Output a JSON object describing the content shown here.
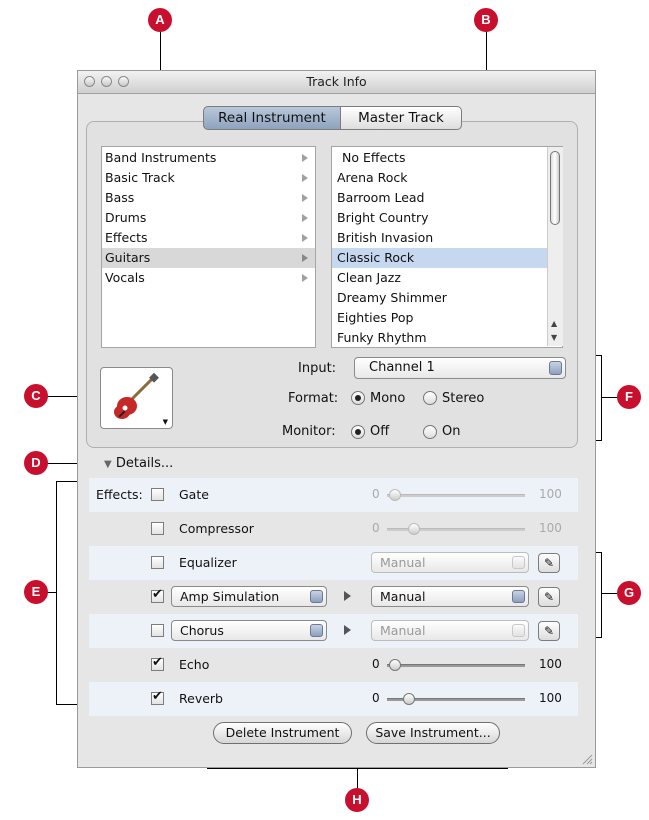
{
  "window": {
    "title": "Track Info"
  },
  "tabs": [
    {
      "label": "Real Instrument",
      "selected": true
    },
    {
      "label": "Master Track",
      "selected": false
    }
  ],
  "categories": [
    "Band Instruments",
    "Basic Track",
    "Bass",
    "Drums",
    "Effects",
    "Guitars",
    "Vocals"
  ],
  "selected_category": "Guitars",
  "presets": [
    "No Effects",
    "Arena Rock",
    "Barroom Lead",
    "Bright Country",
    "British Invasion",
    "Classic Rock",
    "Clean Jazz",
    "Dreamy Shimmer",
    "Eighties Pop",
    "Funky Rhythm"
  ],
  "selected_preset": "Classic Rock",
  "input": {
    "label": "Input:",
    "value": "Channel 1"
  },
  "format": {
    "label": "Format:",
    "options": [
      "Mono",
      "Stereo"
    ],
    "selected": "Mono"
  },
  "monitor": {
    "label": "Monitor:",
    "options": [
      "Off",
      "On"
    ],
    "selected": "Off"
  },
  "details_label": "Details...",
  "effects_label": "Effects:",
  "effects": {
    "gate": {
      "name": "Gate",
      "checked": false,
      "min": "0",
      "max": "100",
      "level": 0.0
    },
    "compressor": {
      "name": "Compressor",
      "checked": false,
      "min": "0",
      "max": "100",
      "level": 0.15
    },
    "equalizer": {
      "name": "Equalizer",
      "checked": false,
      "preset": "Manual"
    },
    "amp": {
      "name": "Amp Simulation",
      "checked": true,
      "preset": "Manual"
    },
    "chorus": {
      "name": "Chorus",
      "checked": false,
      "preset": "Manual"
    },
    "echo": {
      "name": "Echo",
      "checked": true,
      "min": "0",
      "max": "100",
      "level": 0.0
    },
    "reverb": {
      "name": "Reverb",
      "checked": true,
      "min": "0",
      "max": "100",
      "level": 0.12
    }
  },
  "buttons": {
    "delete": "Delete Instrument",
    "save": "Save Instrument..."
  },
  "callouts": [
    "A",
    "B",
    "C",
    "D",
    "E",
    "F",
    "G",
    "H"
  ],
  "colors": {
    "callout": "#c8102e",
    "selection": "#c6d7f0",
    "category_selection": "#d8d8d8"
  }
}
